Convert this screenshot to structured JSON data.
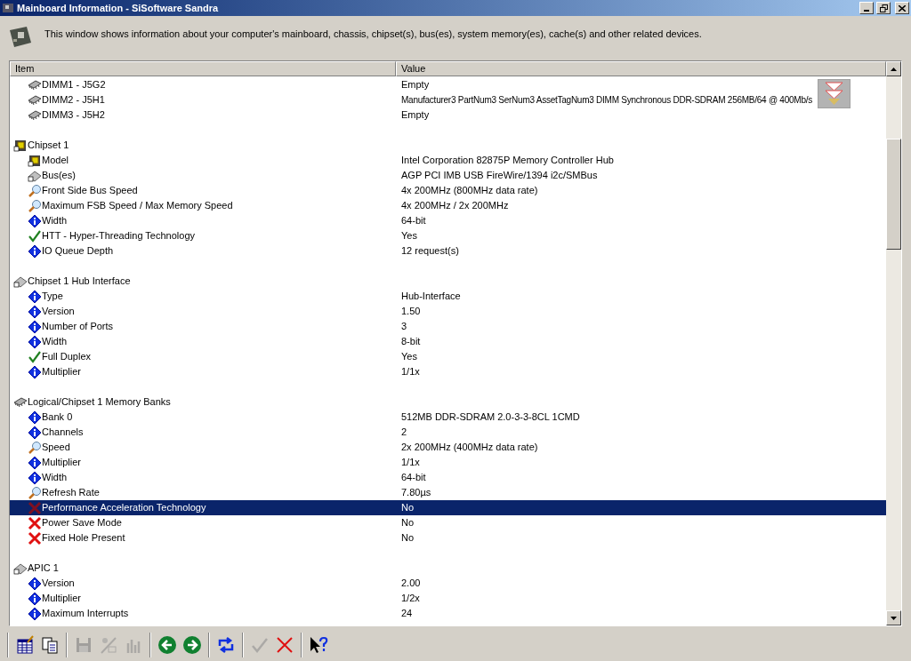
{
  "window": {
    "title": "Mainboard Information - SiSoftware Sandra"
  },
  "description": "This window shows information about your computer's mainboard, chassis, chipset(s), bus(es), system memory(es), cache(s) and other related devices.",
  "table": {
    "columns": [
      "Item",
      "Value"
    ],
    "rows": [
      {
        "kind": "memory",
        "label": "DIMM1 - J5G2",
        "value": "Empty",
        "selected": false
      },
      {
        "kind": "memory",
        "label": "DIMM2 - J5H1",
        "value": "Manufacturer3 PartNum3 SerNum3 AssetTagNum3 DIMM Synchronous DDR-SDRAM 256MB/64 @ 400Mb/s",
        "selected": false
      },
      {
        "kind": "memory",
        "label": "DIMM3 - J5H2",
        "value": "Empty",
        "selected": false
      },
      {
        "kind": "group-chip",
        "label": "Chipset 1",
        "selected": false
      },
      {
        "kind": "chip",
        "label": "Model",
        "value": "Intel Corporation 82875P Memory Controller Hub",
        "selected": false
      },
      {
        "kind": "bus",
        "label": "Bus(es)",
        "value": "AGP PCI IMB USB FireWire/1394 i2c/SMBus",
        "selected": false
      },
      {
        "kind": "speed",
        "label": "Front Side Bus Speed",
        "value": "4x 200MHz (800MHz data rate)",
        "selected": false
      },
      {
        "kind": "speed",
        "label": "Maximum FSB Speed / Max Memory Speed",
        "value": "4x 200MHz / 2x 200MHz",
        "selected": false
      },
      {
        "kind": "info",
        "label": "Width",
        "value": "64-bit",
        "selected": false
      },
      {
        "kind": "yes",
        "label": "HTT - Hyper-Threading Technology",
        "value": "Yes",
        "selected": false
      },
      {
        "kind": "info",
        "label": "IO Queue Depth",
        "value": "12 request(s)",
        "selected": false
      },
      {
        "kind": "group-bus",
        "label": "Chipset 1 Hub Interface",
        "selected": false
      },
      {
        "kind": "info",
        "label": "Type",
        "value": "Hub-Interface",
        "selected": false
      },
      {
        "kind": "info",
        "label": "Version",
        "value": "1.50",
        "selected": false
      },
      {
        "kind": "info",
        "label": "Number of Ports",
        "value": "3",
        "selected": false
      },
      {
        "kind": "info",
        "label": "Width",
        "value": "8-bit",
        "selected": false
      },
      {
        "kind": "yes",
        "label": "Full Duplex",
        "value": "Yes",
        "selected": false
      },
      {
        "kind": "info",
        "label": "Multiplier",
        "value": "1/1x",
        "selected": false
      },
      {
        "kind": "group-memory",
        "label": "Logical/Chipset 1 Memory Banks",
        "selected": false
      },
      {
        "kind": "info",
        "label": "Bank 0",
        "value": "512MB DDR-SDRAM 2.0-3-3-8CL 1CMD",
        "selected": false
      },
      {
        "kind": "info",
        "label": "Channels",
        "value": "2",
        "selected": false
      },
      {
        "kind": "speed",
        "label": "Speed",
        "value": "2x 200MHz (400MHz data rate)",
        "selected": false
      },
      {
        "kind": "info",
        "label": "Multiplier",
        "value": "1/1x",
        "selected": false
      },
      {
        "kind": "info",
        "label": "Width",
        "value": "64-bit",
        "selected": false
      },
      {
        "kind": "speed",
        "label": "Refresh Rate",
        "value": "7.80µs",
        "selected": false
      },
      {
        "kind": "no",
        "label": "Performance Acceleration Technology",
        "value": "No",
        "selected": true
      },
      {
        "kind": "no",
        "label": "Power Save Mode",
        "value": "No",
        "selected": false
      },
      {
        "kind": "no",
        "label": "Fixed Hole Present",
        "value": "No",
        "selected": false
      },
      {
        "kind": "group-bus",
        "label": "APIC 1",
        "selected": false
      },
      {
        "kind": "info",
        "label": "Version",
        "value": "2.00",
        "selected": false
      },
      {
        "kind": "info",
        "label": "Multiplier",
        "value": "1/2x",
        "selected": false
      },
      {
        "kind": "info",
        "label": "Maximum Interrupts",
        "value": "24",
        "selected": false
      }
    ]
  },
  "toolbar": [
    {
      "kind": "report",
      "disabled": false
    },
    {
      "kind": "copy",
      "disabled": false
    },
    {
      "kind": "save",
      "disabled": true
    },
    {
      "kind": "options",
      "disabled": true
    },
    {
      "kind": "chart",
      "disabled": true
    },
    {
      "kind": "back",
      "disabled": false
    },
    {
      "kind": "forward",
      "disabled": false
    },
    {
      "kind": "refresh",
      "disabled": false
    },
    {
      "kind": "ok",
      "disabled": true
    },
    {
      "kind": "cancel",
      "disabled": false
    },
    {
      "kind": "help",
      "disabled": false
    }
  ]
}
